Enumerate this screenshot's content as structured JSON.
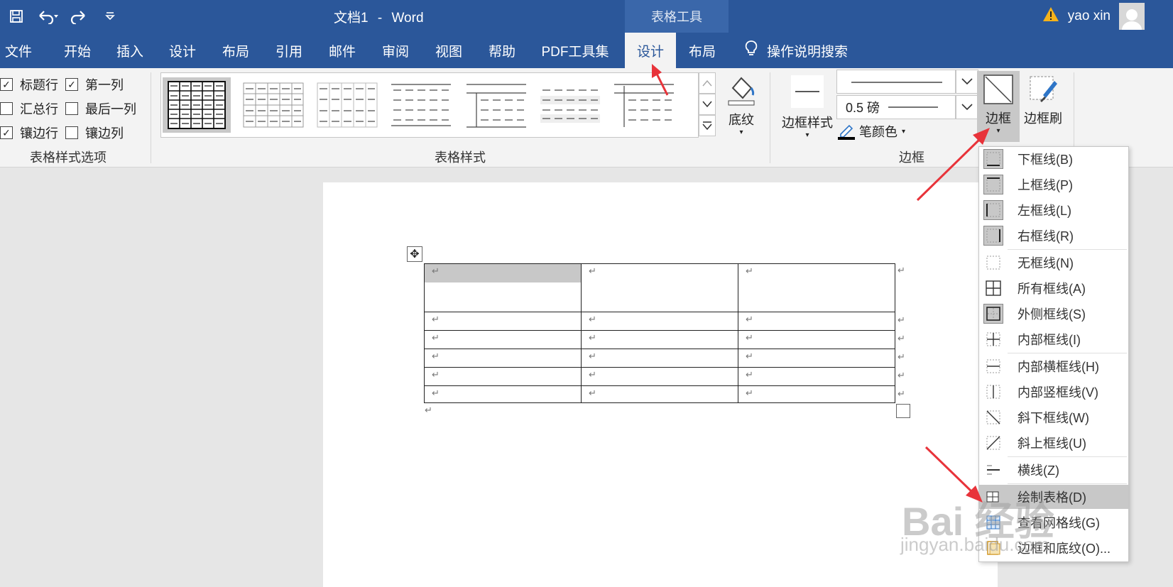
{
  "titlebar": {
    "doc_name": "文档1",
    "separator": "-",
    "app_name": "Word",
    "context_tool": "表格工具",
    "user_name": "yao xin",
    "color": "#2b579a"
  },
  "tabs": [
    "文件",
    "开始",
    "插入",
    "设计",
    "布局",
    "引用",
    "邮件",
    "审阅",
    "视图",
    "帮助",
    "PDF工具集",
    "设计",
    "布局"
  ],
  "active_tab_index": 11,
  "tell_me": "操作说明搜索",
  "style_options": {
    "items": [
      {
        "label": "标题行",
        "checked": true
      },
      {
        "label": "第一列",
        "checked": true
      },
      {
        "label": "汇总行",
        "checked": false
      },
      {
        "label": "最后一列",
        "checked": false
      },
      {
        "label": "镶边行",
        "checked": true
      },
      {
        "label": "镶边列",
        "checked": false
      }
    ],
    "group_label": "表格样式选项"
  },
  "table_styles": {
    "group_label": "表格样式",
    "shading_label": "底纹"
  },
  "borders": {
    "border_styles_label": "边框样式",
    "weight_value": "0.5 磅",
    "pen_color_label": "笔颜色",
    "borders_label": "边框",
    "painter_label": "边框刷",
    "group_label": "边框"
  },
  "border_menu": [
    {
      "label": "下框线(B)",
      "icon": "bottom-border-icon"
    },
    {
      "label": "上框线(P)",
      "icon": "top-border-icon"
    },
    {
      "label": "左框线(L)",
      "icon": "left-border-icon"
    },
    {
      "label": "右框线(R)",
      "icon": "right-border-icon"
    },
    {
      "label": "无框线(N)",
      "icon": "no-border-icon"
    },
    {
      "label": "所有框线(A)",
      "icon": "all-borders-icon"
    },
    {
      "label": "外侧框线(S)",
      "icon": "outside-borders-icon"
    },
    {
      "label": "内部框线(I)",
      "icon": "inside-borders-icon"
    },
    {
      "label": "内部横框线(H)",
      "icon": "inside-horizontal-border-icon"
    },
    {
      "label": "内部竖框线(V)",
      "icon": "inside-vertical-border-icon"
    },
    {
      "label": "斜下框线(W)",
      "icon": "diagonal-down-border-icon"
    },
    {
      "label": "斜上框线(U)",
      "icon": "diagonal-up-border-icon"
    },
    {
      "label": "横线(Z)",
      "icon": "horizontal-line-icon"
    },
    {
      "label": "绘制表格(D)",
      "icon": "draw-table-icon"
    },
    {
      "label": "查看网格线(G)",
      "icon": "view-gridlines-icon"
    },
    {
      "label": "边框和底纹(O)...",
      "icon": "borders-shading-icon"
    }
  ],
  "document": {
    "paragraph_mark": "↵",
    "rows": 6,
    "cols": 3
  },
  "watermark": {
    "main": "Bai 经验",
    "sub": "jingyan.baidu.com"
  },
  "accent": "#e8333a"
}
